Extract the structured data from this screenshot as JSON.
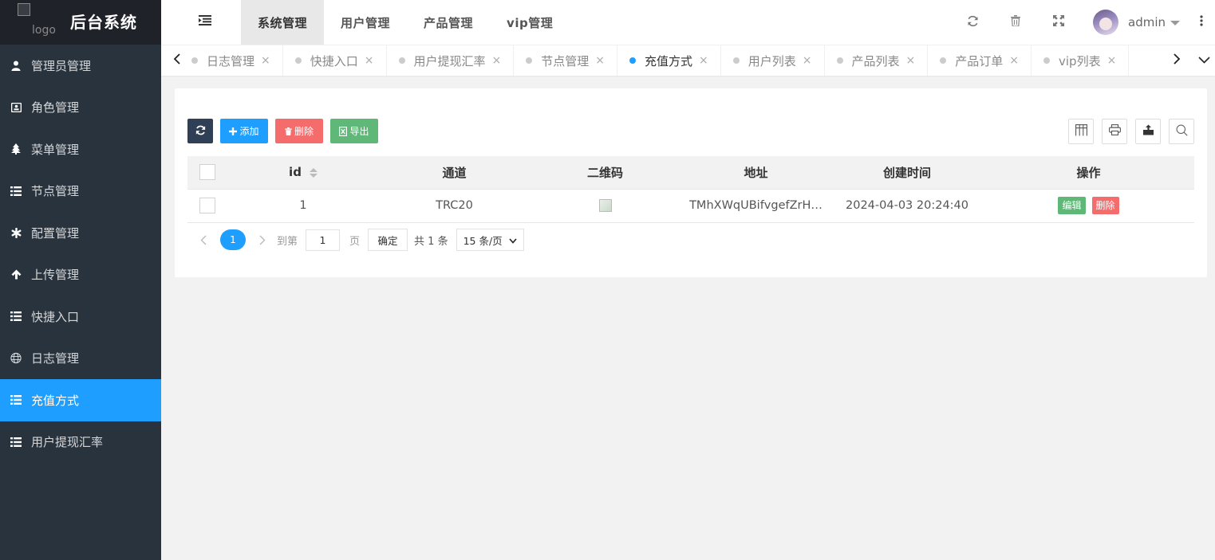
{
  "sidebar": {
    "logo_alt": "logo",
    "title": "后台系统",
    "items": [
      {
        "label": "管理员管理",
        "icon": "user-icon"
      },
      {
        "label": "角色管理",
        "icon": "id-card-icon"
      },
      {
        "label": "菜单管理",
        "icon": "tree-icon"
      },
      {
        "label": "节点管理",
        "icon": "list-icon"
      },
      {
        "label": "配置管理",
        "icon": "asterisk-icon"
      },
      {
        "label": "上传管理",
        "icon": "arrow-up-icon"
      },
      {
        "label": "快捷入口",
        "icon": "list-icon"
      },
      {
        "label": "日志管理",
        "icon": "globe-icon"
      },
      {
        "label": "充值方式",
        "icon": "list-icon",
        "active": true
      },
      {
        "label": "用户提现汇率",
        "icon": "list-icon"
      }
    ]
  },
  "header": {
    "top_tabs": [
      {
        "label": "系统管理",
        "active": true
      },
      {
        "label": "用户管理"
      },
      {
        "label": "产品管理"
      },
      {
        "label": "vip管理"
      }
    ],
    "username": "admin"
  },
  "tabstrip": {
    "tabs": [
      {
        "label": "日志管理"
      },
      {
        "label": "快捷入口"
      },
      {
        "label": "用户提现汇率"
      },
      {
        "label": "节点管理"
      },
      {
        "label": "充值方式",
        "active": true
      },
      {
        "label": "用户列表"
      },
      {
        "label": "产品列表"
      },
      {
        "label": "产品订单"
      },
      {
        "label": "vip列表"
      }
    ],
    "close_glyph": "×"
  },
  "toolbar": {
    "add_label": "添加",
    "delete_label": "删除",
    "export_label": "导出"
  },
  "table": {
    "columns": [
      "id",
      "通道",
      "二维码",
      "地址",
      "创建时间",
      "操作"
    ],
    "rows": [
      {
        "id": "1",
        "channel": "TRC20",
        "address": "TMhXWqUBifvgefZrH…",
        "created": "2024-04-03 20:24:40",
        "edit_label": "编辑",
        "delete_label": "删除"
      }
    ]
  },
  "pagination": {
    "current": "1",
    "goto_label": "到第",
    "goto_value": "1",
    "page_unit": "页",
    "confirm_label": "确定",
    "total_label": "共 1 条",
    "page_size": "15 条/页"
  },
  "colors": {
    "sidebar_bg": "#28333e",
    "logo_bg": "#20222a",
    "accent": "#1e9fff",
    "success": "#5fb878",
    "danger": "#f56c6c",
    "dark_button": "#2f4056"
  }
}
